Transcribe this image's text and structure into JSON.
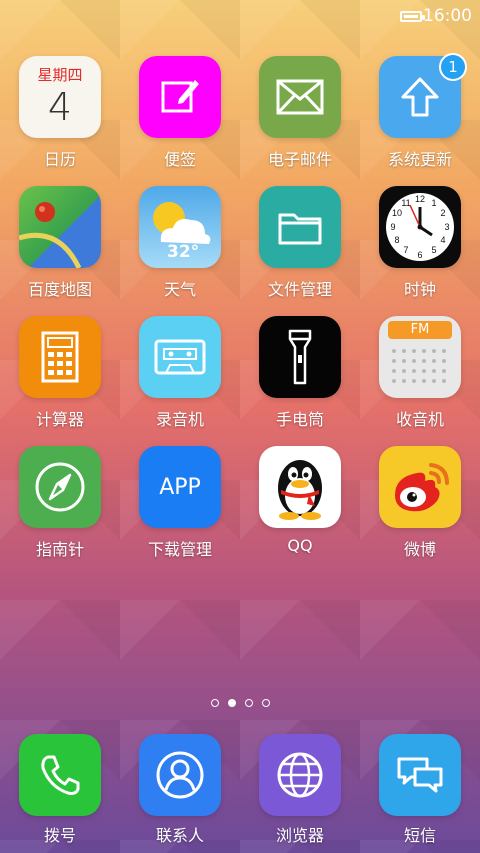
{
  "status": {
    "time": "16:00"
  },
  "rows": [
    [
      {
        "id": "calendar",
        "label": "日历",
        "header": "星期四",
        "day": "4"
      },
      {
        "id": "notes",
        "label": "便签"
      },
      {
        "id": "mail",
        "label": "电子邮件"
      },
      {
        "id": "update",
        "label": "系统更新",
        "badge": "1"
      }
    ],
    [
      {
        "id": "maps",
        "label": "百度地图"
      },
      {
        "id": "weather",
        "label": "天气",
        "temp": "32°"
      },
      {
        "id": "files",
        "label": "文件管理"
      },
      {
        "id": "clock",
        "label": "时钟"
      }
    ],
    [
      {
        "id": "calculator",
        "label": "计算器"
      },
      {
        "id": "recorder",
        "label": "录音机"
      },
      {
        "id": "flashlight",
        "label": "手电筒"
      },
      {
        "id": "radio",
        "label": "收音机",
        "badge_text": "FM"
      }
    ],
    [
      {
        "id": "compass",
        "label": "指南针"
      },
      {
        "id": "download",
        "label": "下载管理",
        "icon_text": "APP"
      },
      {
        "id": "qq",
        "label": "QQ"
      },
      {
        "id": "weibo",
        "label": "微博"
      }
    ]
  ],
  "dock": [
    {
      "id": "phone",
      "label": "拨号"
    },
    {
      "id": "contacts",
      "label": "联系人"
    },
    {
      "id": "browser",
      "label": "浏览器"
    },
    {
      "id": "sms",
      "label": "短信"
    }
  ],
  "page_count": 4,
  "active_page": 2,
  "colors": {
    "calendar": "#f8f5ee",
    "notes": "#ff00ff",
    "mail": "#79a84a",
    "update": "#4aa8ee",
    "maps": "#3aa24d",
    "weather": "#7ec9f2",
    "files": "#2aaca3",
    "clock": "#0b0b0b",
    "calculator": "#f18d0a",
    "recorder": "#5bd0f2",
    "flashlight": "#050505",
    "radio": "#e8e8e8",
    "compass": "#4cae4f",
    "download": "#1b7df3",
    "qq": "#ffffff",
    "weibo": "#f7c928",
    "phone": "#2ac43b",
    "contacts": "#2f7ff3",
    "browser": "#7b58d6",
    "sms": "#2fa5ea"
  }
}
